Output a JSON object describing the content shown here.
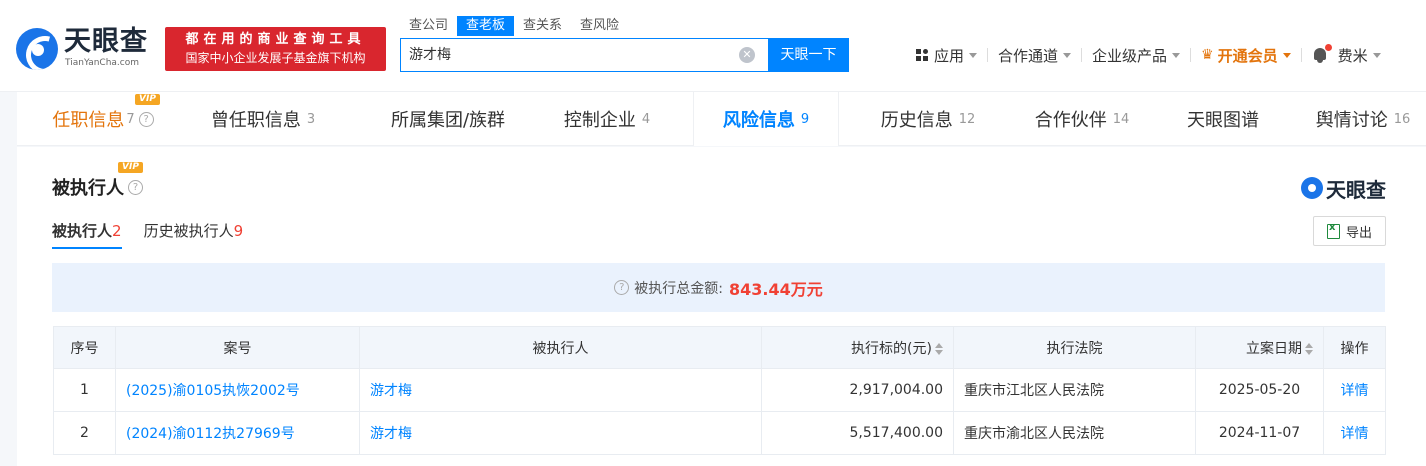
{
  "header": {
    "logo_text": "天眼查",
    "logo_sub": "TianYanCha.com",
    "slogan_line1": "都在用的商业查询工具",
    "slogan_line2": "国家中小企业发展子基金旗下机构",
    "search_tabs": [
      "查公司",
      "查老板",
      "查关系",
      "查风险"
    ],
    "active_search_tab": "查老板",
    "search_value": "游才梅",
    "search_button": "天眼一下",
    "nav": {
      "apps": "应用",
      "cooperation": "合作通道",
      "enterprise": "企业级产品",
      "vip": "开通会员",
      "user": "费米"
    },
    "accent_color": "#0084ff",
    "slogan_color": "#d9262e"
  },
  "tabs": [
    {
      "label": "任职信息",
      "count": "7",
      "vip": "VIP"
    },
    {
      "label": "曾任职信息",
      "count": "3"
    },
    {
      "label": "所属集团/族群",
      "count": ""
    },
    {
      "label": "控制企业",
      "count": "4"
    },
    {
      "label": "风险信息",
      "count": "9"
    },
    {
      "label": "历史信息",
      "count": "12"
    },
    {
      "label": "合作伙伴",
      "count": "14"
    },
    {
      "label": "天眼图谱",
      "count": ""
    },
    {
      "label": "舆情讨论",
      "count": "16"
    }
  ],
  "section": {
    "title": "被执行人",
    "vip": "VIP",
    "brand": "天眼查",
    "subtabs": [
      {
        "label": "被执行人",
        "count": "2"
      },
      {
        "label": "历史被执行人",
        "count": "9"
      }
    ],
    "export_label": "导出",
    "summary_label": "被执行总金额:",
    "summary_amount": "843.44万元"
  },
  "table": {
    "headers": [
      "序号",
      "案号",
      "被执行人",
      "执行标的(元)",
      "执行法院",
      "立案日期",
      "操作"
    ],
    "rows": [
      {
        "index": "1",
        "case_no": "(2025)渝0105执恢2002号",
        "person": "游才梅",
        "amount": "2,917,004.00",
        "court": "重庆市江北区人民法院",
        "date": "2025-05-20",
        "action": "详情"
      },
      {
        "index": "2",
        "case_no": "(2024)渝0112执27969号",
        "person": "游才梅",
        "amount": "5,517,400.00",
        "court": "重庆市渝北区人民法院",
        "date": "2024-11-07",
        "action": "详情"
      }
    ]
  }
}
